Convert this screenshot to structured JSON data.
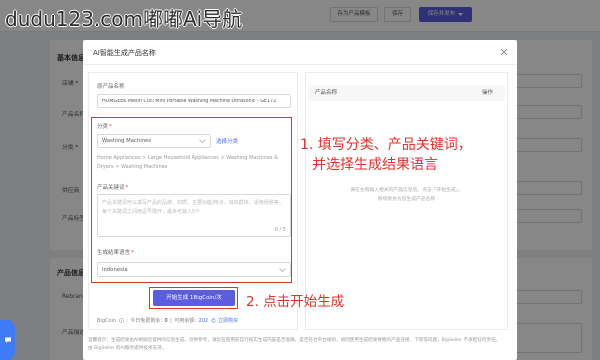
{
  "watermark": "dudu123.com嘟嘟Ai导航",
  "background": {
    "topbar": {
      "template_button": "存为产品模板",
      "save_button": "保存",
      "publish_button": "保存并发布"
    },
    "basic_section": {
      "title": "基本信息",
      "fields": [
        "店铺 *",
        "产品名称",
        "分类 *",
        "供应商",
        "产品标签"
      ]
    },
    "product_section": {
      "title": "产品信息",
      "fields": [
        "Rebrand",
        "产品描述"
      ]
    }
  },
  "modal": {
    "title": "AI智能生成产品名称",
    "form": {
      "required_mark": "*",
      "original_name": {
        "label": "原产品名称",
        "value": "HOMGEEK Mesin Cuci Mini Portable Washing Machine Ultrasonic - GE172"
      },
      "category": {
        "label": "分类",
        "value": "Washing Machines",
        "choose_link": "选择分类",
        "path": "Home Appliances > Large Household Appliances > Washing Machines & Dryers > Washing Machines"
      },
      "keywords": {
        "label": "产品关键词",
        "placeholder": "产品关键词可以填写产品的品牌、材质、主要功能/特点、目标群体、适用场景等，每个关键词之间用逗号隔开，最多可输入5个",
        "counter": "0 / 5"
      },
      "language": {
        "label": "生成结果语言",
        "value": "Indonesia"
      },
      "generate_button": "开始生成 1BigCoin/次",
      "bigcoin": {
        "label": "BigCoin",
        "separator": ":",
        "free_label": "今日免费剩余:",
        "free_value": "0",
        "divider": "|",
        "balance_label": "可用余额:",
        "balance_value": "202",
        "buy_link": "立即购买"
      }
    },
    "results": {
      "columns": [
        "产品名称",
        "操作"
      ],
      "empty_text": [
        "请在左侧输入相关的产品信息后，点击「开始生成」，",
        "系统将会为您生成产品名称"
      ]
    },
    "footer_note": [
      "温馨提示：生成结果由AI根据您提供的信息生成，仅供参考，请您在使用前自行核实生成内容是否准确、是否符合平台规则，如因使用生成结果导致的产品违规、下架等问题，BigSeller 不承担任何责任，",
      "由 BigSeller 的AI服务提供技术支持。"
    ]
  },
  "annotations": {
    "step1_line1": "1. 填写分类、产品关键词，",
    "step1_line2": "并选择生成结果语言",
    "step2": "2. 点击开始生成"
  },
  "icons": [
    "close-icon",
    "chevron-down-icon",
    "info-icon",
    "refresh-icon",
    "caret-down-icon",
    "chat-icon"
  ],
  "colors": {
    "accent": "#5b5ce0",
    "annotation_red": "#e4322b",
    "link_blue": "#4f6ef7",
    "overlay": "rgba(0,0,0,0.47)"
  }
}
